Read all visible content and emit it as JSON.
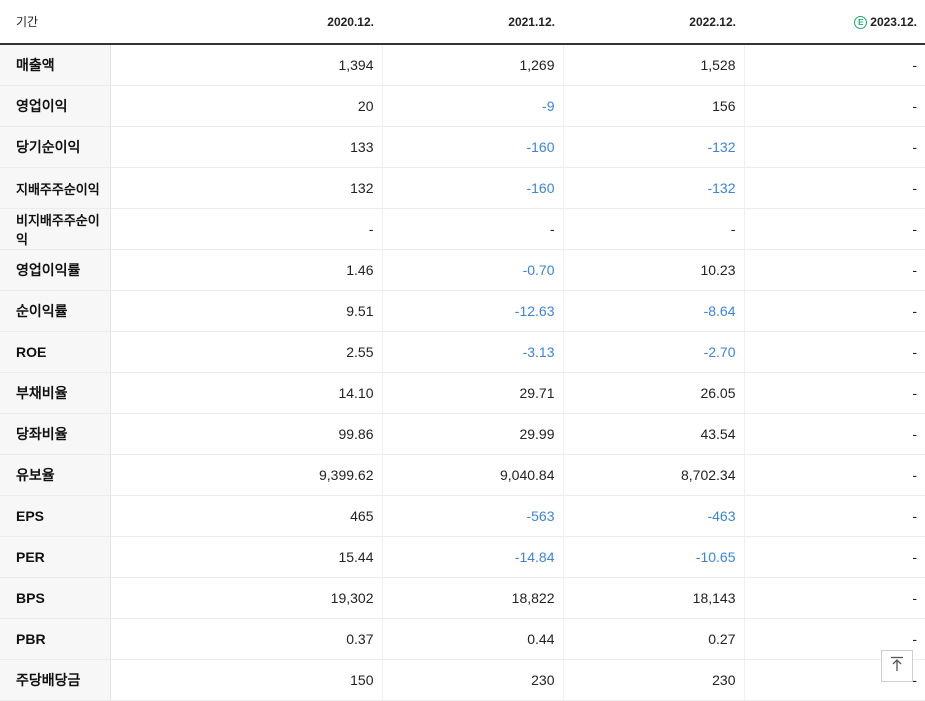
{
  "header": {
    "period_label": "기간",
    "years": [
      "2020.12.",
      "2021.12.",
      "2022.12.",
      "2023.12."
    ],
    "estimate_badge": "E"
  },
  "rows": [
    {
      "label": "매출액",
      "values": [
        "1,394",
        "1,269",
        "1,528",
        "-"
      ]
    },
    {
      "label": "영업이익",
      "values": [
        "20",
        "-9",
        "156",
        "-"
      ]
    },
    {
      "label": "당기순이익",
      "values": [
        "133",
        "-160",
        "-132",
        "-"
      ]
    },
    {
      "label": "지배주주순이익",
      "values": [
        "132",
        "-160",
        "-132",
        "-"
      ]
    },
    {
      "label": "비지배주주순이익",
      "values": [
        "-",
        "-",
        "-",
        "-"
      ]
    },
    {
      "label": "영업이익률",
      "values": [
        "1.46",
        "-0.70",
        "10.23",
        "-"
      ]
    },
    {
      "label": "순이익률",
      "values": [
        "9.51",
        "-12.63",
        "-8.64",
        "-"
      ]
    },
    {
      "label": "ROE",
      "values": [
        "2.55",
        "-3.13",
        "-2.70",
        "-"
      ]
    },
    {
      "label": "부채비율",
      "values": [
        "14.10",
        "29.71",
        "26.05",
        "-"
      ]
    },
    {
      "label": "당좌비율",
      "values": [
        "99.86",
        "29.99",
        "43.54",
        "-"
      ]
    },
    {
      "label": "유보율",
      "values": [
        "9,399.62",
        "9,040.84",
        "8,702.34",
        "-"
      ]
    },
    {
      "label": "EPS",
      "values": [
        "465",
        "-563",
        "-463",
        "-"
      ]
    },
    {
      "label": "PER",
      "values": [
        "15.44",
        "-14.84",
        "-10.65",
        "-"
      ]
    },
    {
      "label": "BPS",
      "values": [
        "19,302",
        "18,822",
        "18,143",
        "-"
      ]
    },
    {
      "label": "PBR",
      "values": [
        "0.37",
        "0.44",
        "0.27",
        "-"
      ]
    },
    {
      "label": "주당배당금",
      "values": [
        "150",
        "230",
        "230",
        "-"
      ]
    }
  ],
  "colors": {
    "negative": "#3b84d9",
    "estimate": "#20a96a"
  },
  "scroll_top_icon": "arrow-up-to-line-icon"
}
